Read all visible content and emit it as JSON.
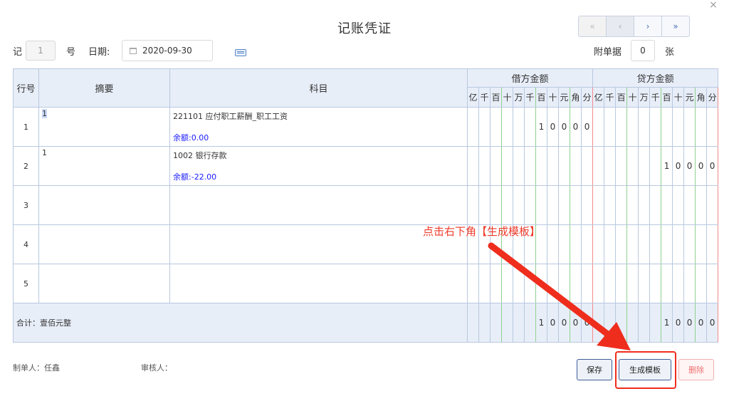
{
  "title": "记账凭证",
  "close_icon": "close-icon",
  "pager": {
    "first": "«",
    "prev": "‹",
    "next": "›",
    "last": "»"
  },
  "header": {
    "word_label": "记",
    "number_value": "1",
    "number_suffix": "号",
    "date_label": "日期:",
    "date_value": "2020-09-30",
    "attach_label": "附单据",
    "attach_value": "0",
    "attach_suffix": "张"
  },
  "table": {
    "col_row_no": "行号",
    "col_summary": "摘要",
    "col_subject": "科目",
    "col_debit": "借方金额",
    "col_credit": "贷方金额",
    "digit_units": [
      "亿",
      "千",
      "百",
      "十",
      "万",
      "千",
      "百",
      "十",
      "元",
      "角",
      "分"
    ],
    "rows": [
      {
        "no": "1",
        "summary": "1",
        "subject": "221101 应付职工薪酬_职工工资",
        "balance_label": "余额:",
        "balance": "0.00",
        "debit": [
          "",
          "",
          "",
          "",
          "",
          "",
          "1",
          "0",
          "0",
          "0",
          "0"
        ],
        "credit": [
          "",
          "",
          "",
          "",
          "",
          "",
          "",
          "",
          "",
          "",
          ""
        ]
      },
      {
        "no": "2",
        "summary": "1",
        "subject": "1002 银行存款",
        "balance_label": "余额:",
        "balance": "-22.00",
        "debit": [
          "",
          "",
          "",
          "",
          "",
          "",
          "",
          "",
          "",
          "",
          ""
        ],
        "credit": [
          "",
          "",
          "",
          "",
          "",
          "",
          "1",
          "0",
          "0",
          "0",
          "0"
        ]
      },
      {
        "no": "3",
        "summary": "",
        "subject": "",
        "balance_label": "",
        "balance": "",
        "debit": [
          "",
          "",
          "",
          "",
          "",
          "",
          "",
          "",
          "",
          "",
          ""
        ],
        "credit": [
          "",
          "",
          "",
          "",
          "",
          "",
          "",
          "",
          "",
          "",
          ""
        ]
      },
      {
        "no": "4",
        "summary": "",
        "subject": "",
        "balance_label": "",
        "balance": "",
        "debit": [
          "",
          "",
          "",
          "",
          "",
          "",
          "",
          "",
          "",
          "",
          ""
        ],
        "credit": [
          "",
          "",
          "",
          "",
          "",
          "",
          "",
          "",
          "",
          "",
          ""
        ]
      },
      {
        "no": "5",
        "summary": "",
        "subject": "",
        "balance_label": "",
        "balance": "",
        "debit": [
          "",
          "",
          "",
          "",
          "",
          "",
          "",
          "",
          "",
          "",
          ""
        ],
        "credit": [
          "",
          "",
          "",
          "",
          "",
          "",
          "",
          "",
          "",
          "",
          ""
        ]
      }
    ],
    "total_label": "合计：壹佰元整",
    "total_debit": [
      "",
      "",
      "",
      "",
      "",
      "",
      "1",
      "0",
      "0",
      "0",
      "0"
    ],
    "total_credit": [
      "",
      "",
      "",
      "",
      "",
      "",
      "1",
      "0",
      "0",
      "0",
      "0"
    ]
  },
  "footer": {
    "maker": "制单人：任鑫",
    "reviewer": "审核人："
  },
  "buttons": {
    "save": "保存",
    "template": "生成模板",
    "delete": "删除"
  },
  "annotation": "点击右下角【生成模板】",
  "colors": {
    "accent": "#3f5e98",
    "annotation": "#ef2d1d",
    "balance": "#1a1aff",
    "header_bg": "#e8eef8"
  }
}
